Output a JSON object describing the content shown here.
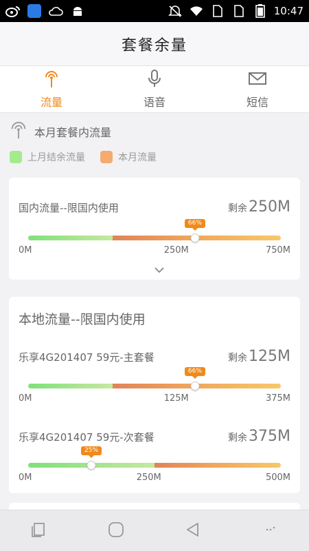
{
  "status": {
    "time": "10:47",
    "left_icons": [
      "weibo-icon",
      "cloud-app-icon",
      "cloud-icon",
      "android-icon"
    ],
    "right_icons": [
      "mute-icon",
      "wifi-icon",
      "sim1-icon",
      "sim2-icon",
      "battery-icon"
    ]
  },
  "title": "套餐余量",
  "tabs": [
    {
      "label": "流量",
      "icon": "signal-tower-icon",
      "active": true
    },
    {
      "label": "语音",
      "icon": "microphone-icon",
      "active": false
    },
    {
      "label": "短信",
      "icon": "envelope-icon",
      "active": false
    }
  ],
  "section": {
    "title": "本月套餐内流量",
    "legend_last": "上月结余流量",
    "legend_this": "本月流量"
  },
  "colors": {
    "accent": "#f08a1c",
    "legend_green": "#a6ea8e",
    "legend_orange": "#f4aa70"
  },
  "card1": {
    "label": "国内流量--限国内使用",
    "remain_prefix": "剩余",
    "remain_value": "250M",
    "percent_label": "66%",
    "percent": 0.66,
    "split": 0.333,
    "ticks": [
      "0M",
      "250M",
      "750M"
    ]
  },
  "card2": {
    "title": "本地流量--限国内使用",
    "rows": [
      {
        "label": "乐享4G201407 59元-主套餐",
        "remain_prefix": "剩余",
        "remain_value": "125M",
        "percent_label": "66%",
        "percent": 0.66,
        "split": 0.333,
        "ticks": [
          "0M",
          "125M",
          "375M"
        ]
      },
      {
        "label": "乐享4G201407 59元-次套餐",
        "remain_prefix": "剩余",
        "remain_value": "375M",
        "percent_label": "25%",
        "percent": 0.25,
        "split": 0.5,
        "ticks": [
          "0M",
          "250M",
          "500M"
        ]
      }
    ]
  },
  "nav": [
    "recent-apps-icon",
    "home-icon",
    "back-icon",
    "menu-dots-icon"
  ]
}
